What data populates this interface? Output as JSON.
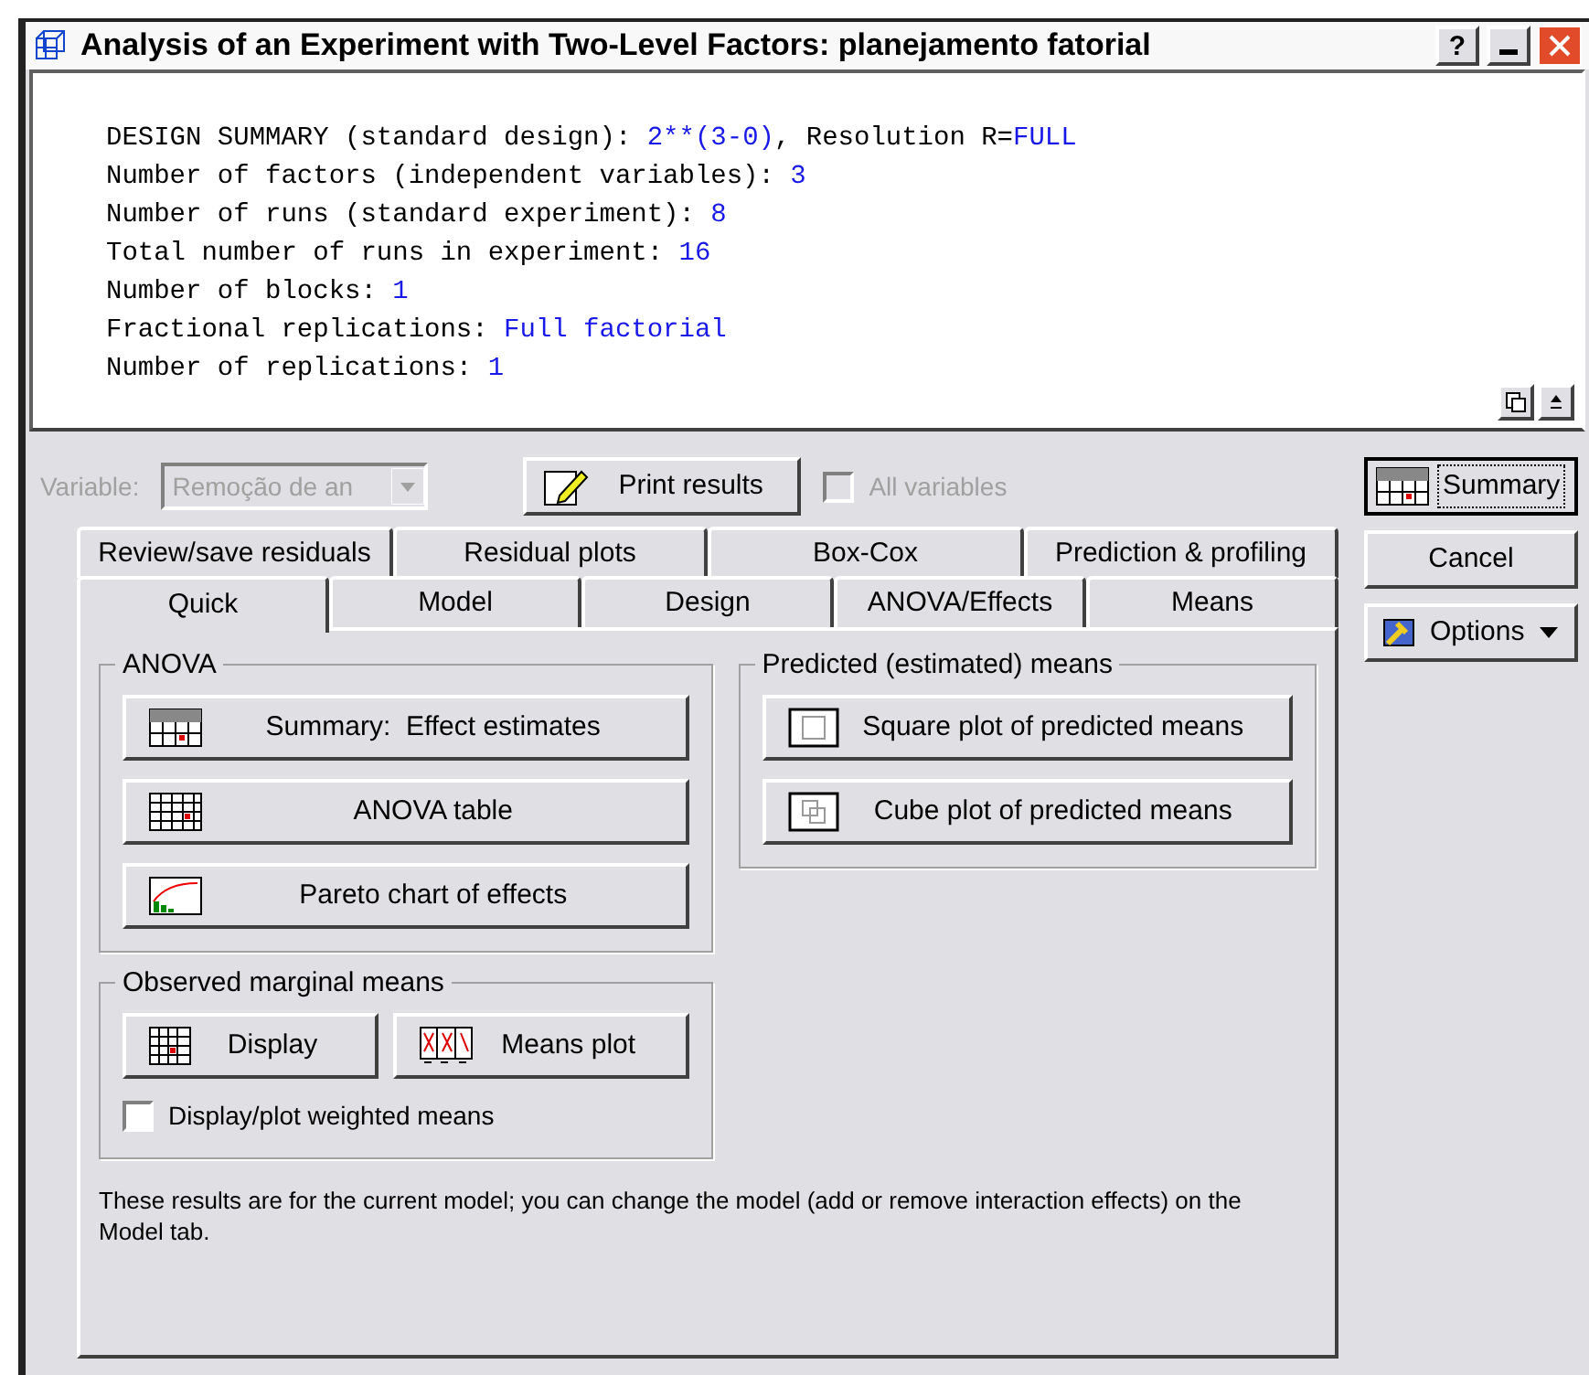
{
  "window": {
    "title": "Analysis of an Experiment with Two-Level Factors: planejamento fatorial",
    "help": "?"
  },
  "summary": {
    "lines": [
      {
        "segments": [
          {
            "kind": "label",
            "text": "DESIGN SUMMARY (standard design): "
          },
          {
            "kind": "value",
            "text": "2**(3-0)"
          },
          {
            "kind": "label",
            "text": ", Resolution R="
          },
          {
            "kind": "value",
            "text": "FULL"
          }
        ]
      },
      {
        "segments": [
          {
            "kind": "label",
            "text": "Number of factors (independent variables): "
          },
          {
            "kind": "value",
            "text": "3"
          }
        ]
      },
      {
        "segments": [
          {
            "kind": "label",
            "text": "Number of runs (standard experiment): "
          },
          {
            "kind": "value",
            "text": "8"
          }
        ]
      },
      {
        "segments": [
          {
            "kind": "label",
            "text": "Total number of runs in experiment: "
          },
          {
            "kind": "value",
            "text": "16"
          }
        ]
      },
      {
        "segments": [
          {
            "kind": "label",
            "text": "Number of blocks: "
          },
          {
            "kind": "value",
            "text": "1"
          }
        ]
      },
      {
        "segments": [
          {
            "kind": "label",
            "text": "Fractional replications: "
          },
          {
            "kind": "value",
            "text": "Full factorial"
          }
        ]
      },
      {
        "segments": [
          {
            "kind": "label",
            "text": "Number of replications: "
          },
          {
            "kind": "value",
            "text": "1"
          }
        ]
      }
    ]
  },
  "variable": {
    "label": "Variable:",
    "value": "Remoção de an",
    "disabled": true
  },
  "print_button": {
    "label": "Print results"
  },
  "all_variables": {
    "label": "All variables",
    "checked": false,
    "disabled": true
  },
  "side_buttons": [
    {
      "kind": "summary",
      "label": "Summary"
    },
    {
      "kind": "plain",
      "label": "Cancel"
    },
    {
      "kind": "options",
      "label": "Options"
    }
  ],
  "tab_rows": [
    [
      {
        "label": "Review/save residuals",
        "selected": false
      },
      {
        "label": "Residual plots",
        "selected": false
      },
      {
        "label": "Box-Cox",
        "selected": false
      },
      {
        "label": "Prediction & profiling",
        "selected": false
      }
    ],
    [
      {
        "label": "Quick",
        "selected": true
      },
      {
        "label": "Model",
        "selected": false
      },
      {
        "label": "Design",
        "selected": false
      },
      {
        "label": "ANOVA/Effects",
        "selected": false
      },
      {
        "label": "Means",
        "selected": false
      }
    ]
  ],
  "anova": {
    "title": "ANOVA",
    "buttons": [
      {
        "kind": "summary",
        "label": "Summary:  Effect estimates"
      },
      {
        "kind": "table",
        "label": "ANOVA table"
      },
      {
        "kind": "pareto",
        "label": "Pareto chart of effects"
      }
    ]
  },
  "predicted": {
    "title": "Predicted (estimated) means",
    "buttons": [
      {
        "kind": "square",
        "label": "Square plot of predicted means"
      },
      {
        "kind": "cube",
        "label": "Cube plot of predicted means"
      }
    ]
  },
  "observed": {
    "title": "Observed marginal means",
    "buttons": [
      {
        "kind": "grid",
        "label": "Display"
      },
      {
        "kind": "means",
        "label": "Means plot"
      }
    ],
    "checkbox": {
      "label": "Display/plot weighted means",
      "checked": false
    }
  },
  "note": "These results are for the current model; you can change the model (add or remove interaction effects) on the Model tab."
}
